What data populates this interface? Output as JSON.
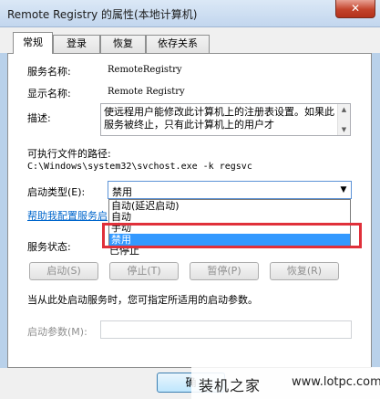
{
  "window": {
    "title": "Remote Registry 的属性(本地计算机)",
    "close_glyph": "✕"
  },
  "tabs": [
    {
      "label": "常规",
      "active": true
    },
    {
      "label": "登录",
      "active": false
    },
    {
      "label": "恢复",
      "active": false
    },
    {
      "label": "依存关系",
      "active": false
    }
  ],
  "general": {
    "service_name_label": "服务名称:",
    "service_name": "RemoteRegistry",
    "display_name_label": "显示名称:",
    "display_name": "Remote Registry",
    "description_label": "描述:",
    "description": "使远程用户能修改此计算机上的注册表设置。如果此服务被终止，只有此计算机上的用户才",
    "exe_path_label": "可执行文件的路径:",
    "exe_path": "C:\\Windows\\system32\\svchost.exe -k regsvc",
    "startup_type_label": "启动类型(E):",
    "startup_type_value": "禁用",
    "startup_options": [
      "自动(延迟启动)",
      "自动",
      "手动",
      "禁用"
    ],
    "help_link": "帮助我配置服务启",
    "service_status_label": "服务状态:",
    "service_status_value": "已停止",
    "buttons": {
      "start": "启动(S)",
      "stop": "停止(T)",
      "pause": "暂停(P)",
      "resume": "恢复(R)"
    },
    "hint": "当从此处启动服务时，您可指定所适用的启动参数。",
    "start_params_label": "启动参数(M):",
    "start_params_value": ""
  },
  "footer": {
    "ok_label": "确"
  },
  "watermark": {
    "text": "装机之家",
    "url": "www.lotpc.com"
  },
  "colors": {
    "selection": "#3399ff",
    "highlight_frame": "#e0303a",
    "link": "#0066cc"
  }
}
